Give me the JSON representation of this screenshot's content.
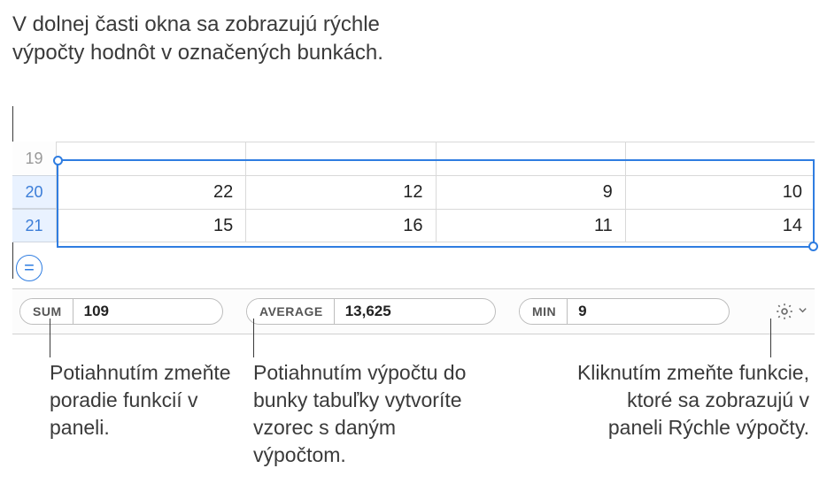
{
  "top_callout": "V dolnej časti okna sa zobrazujú rýchle výpočty hodnôt v označených bunkách.",
  "rows": {
    "header19": "19",
    "header20": "20",
    "header21": "21",
    "r20": {
      "c1": "22",
      "c2": "12",
      "c3": "9",
      "c4": "10"
    },
    "r21": {
      "c1": "15",
      "c2": "16",
      "c3": "11",
      "c4": "14"
    }
  },
  "equals_symbol": "=",
  "panel": {
    "sum": {
      "label": "SUM",
      "value": "109"
    },
    "average": {
      "label": "AVERAGE",
      "value": "13,625"
    },
    "min": {
      "label": "MIN",
      "value": "9"
    }
  },
  "callouts": {
    "left": "Potiahnutím zmeňte poradie funkcií v paneli.",
    "mid": "Potiahnutím výpočtu do bunky tabuľky vytvoríte vzorec s daným výpočtom.",
    "right": "Kliknutím zmeňte funkcie, ktoré sa zobrazujú v paneli Rýchle výpočty."
  }
}
